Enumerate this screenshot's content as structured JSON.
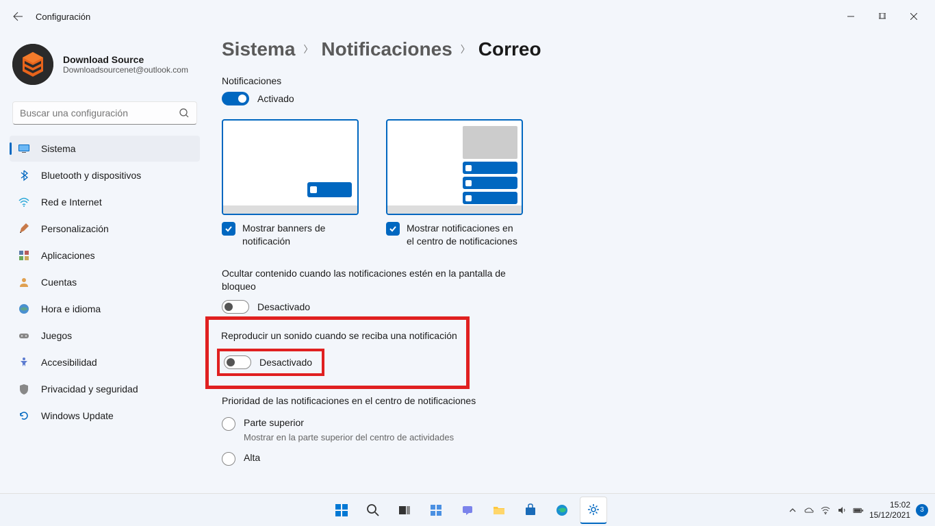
{
  "window": {
    "title": "Configuración"
  },
  "profile": {
    "name": "Download Source",
    "email": "Downloadsourcenet@outlook.com"
  },
  "search": {
    "placeholder": "Buscar una configuración"
  },
  "sidebar": {
    "items": [
      {
        "label": "Sistema"
      },
      {
        "label": "Bluetooth y dispositivos"
      },
      {
        "label": "Red e Internet"
      },
      {
        "label": "Personalización"
      },
      {
        "label": "Aplicaciones"
      },
      {
        "label": "Cuentas"
      },
      {
        "label": "Hora e idioma"
      },
      {
        "label": "Juegos"
      },
      {
        "label": "Accesibilidad"
      },
      {
        "label": "Privacidad y seguridad"
      },
      {
        "label": "Windows Update"
      }
    ]
  },
  "breadcrumb": {
    "l1": "Sistema",
    "l2": "Notificaciones",
    "current": "Correo"
  },
  "main": {
    "notifications_label": "Notificaciones",
    "toggle_on_label": "Activado",
    "banner_check": "Mostrar banners de notificación",
    "center_check": "Mostrar notificaciones en el centro de notificaciones",
    "hide_content_label": "Ocultar contenido cuando las notificaciones estén en la pantalla de bloqueo",
    "hide_content_state": "Desactivado",
    "play_sound_label": "Reproducir un sonido cuando se reciba una notificación",
    "play_sound_state": "Desactivado",
    "priority_title": "Prioridad de las notificaciones en el centro de notificaciones",
    "priority_top": "Parte superior",
    "priority_top_sub": "Mostrar en la parte superior del centro de actividades",
    "priority_high": "Alta"
  },
  "taskbar": {
    "time": "15:02",
    "date": "15/12/2021",
    "badge": "3"
  }
}
